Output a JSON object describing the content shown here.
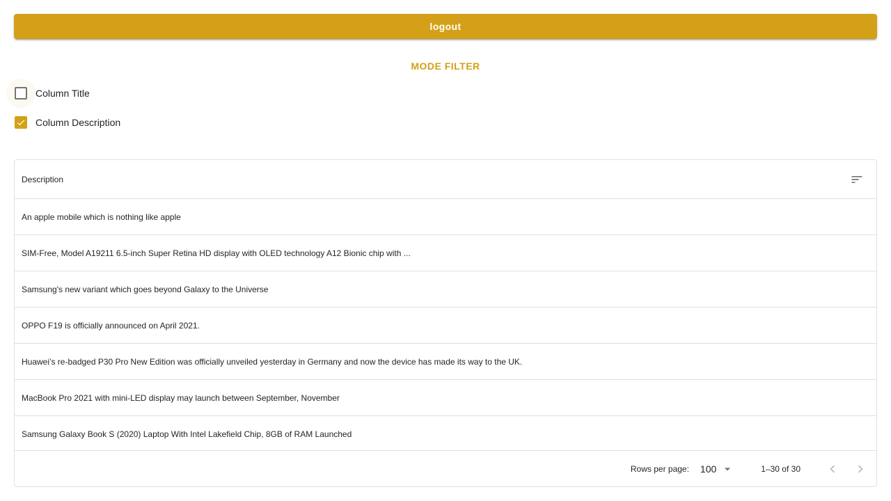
{
  "header": {
    "logout_label": "logout"
  },
  "filter": {
    "mode_filter_label": "MODE FILTER",
    "options": [
      {
        "label": "Column Title",
        "checked": false
      },
      {
        "label": "Column Description",
        "checked": true
      }
    ]
  },
  "table": {
    "column_header": "Description",
    "rows": [
      "An apple mobile which is nothing like apple",
      "SIM-Free, Model A19211 6.5-inch Super Retina HD display with OLED technology A12 Bionic chip with ...",
      "Samsung's new variant which goes beyond Galaxy to the Universe",
      "OPPO F19 is officially announced on April 2021.",
      "Huawei’s re-badged P30 Pro New Edition was officially unveiled yesterday in Germany and now the device has made its way to the UK.",
      "MacBook Pro 2021 with mini-LED display may launch between September, November",
      "Samsung Galaxy Book S (2020) Laptop With Intel Lakefield Chip, 8GB of RAM Launched"
    ]
  },
  "pagination": {
    "rows_per_page_label": "Rows per page:",
    "rows_per_page_value": "100",
    "range_text": "1–30 of 30"
  },
  "colors": {
    "accent": "#d4a017",
    "border": "#e0e0e0"
  },
  "icons": {
    "sort": "sort-icon",
    "dropdown": "arrow-drop-down-icon",
    "prev": "chevron-left-icon",
    "next": "chevron-right-icon",
    "check": "check-icon"
  }
}
